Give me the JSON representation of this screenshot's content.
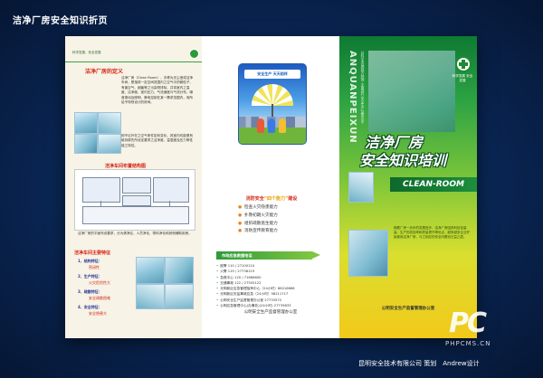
{
  "page": {
    "title": "洁净厂房安全知识折页"
  },
  "left": {
    "header_text": "科学发展，安全发展",
    "section1_title": "洁净厂房的定义",
    "section1_body": "洁净厂房（Clean Room），亦称为无尘室或洁净车间，是指将一定空间范围内之空气中的微粒子、有害空气、细菌等之污染物排除，并将室内之温度、洁净度、室内压力、气流速度与气流分布、噪音振动及照明、静电控制在某一需求范围内，而所给予特别设计的房间。",
    "section1_body2": "即不论外在之空气条件如何变化，其室内均能俱有维持原先所设定要求之洁净度、温湿度及压力等性能之特性。",
    "section2_title": "洁净车间布置结构图",
    "section2_body": "洁净厂房的平面布设要求，分为清净区、人员净化、物料净化和其他辅助用房。",
    "section3_title": "洁净车间主要特征",
    "features": [
      {
        "label": "1、结构特征：",
        "value": "密闭性"
      },
      {
        "label": "2、生产特征：",
        "value": "火灾危险性大"
      },
      {
        "label": "3、疏散特征：",
        "value": "安全疏散困难"
      },
      {
        "label": "4、安全特征：",
        "value": "安全隐患大"
      }
    ]
  },
  "middle": {
    "poster_title": "安全生产 天天相伴",
    "headline_prefix": "消防安全",
    "headline_quote": "“四个能力”",
    "headline_suffix": "建设",
    "capabilities": [
      "检查火灾隐患能力",
      "扑救初期火灾能力",
      "组织疏散逃生能力",
      "消防宣传教育能力"
    ],
    "emergency_title": "市政应急救援电话",
    "emergency": [
      "匪警 110 / 27100110",
      "火警 119 / 27738119",
      "急救中心 120 / 71666600",
      "交通事故 122 / 27555122",
      "光明新区应急管理指挥中心（24小时）88216666",
      "光明新区安监事故应急（24小时）98211717",
      "公明安全生产监督管理办公室 27733572",
      "公明应急管理中心(办事处)(24小时) 27739833"
    ],
    "footer": "公明安全生产监督管理办公室"
  },
  "right": {
    "vertical_en": "ANQUANPEIXUN",
    "vertical_cn": "以科学发展观为统领 全面提升安全生产监管水平",
    "logo_text": "科学发展 安全发展",
    "title_line1": "洁净厂房",
    "title_line2": "安全知识培训",
    "clean_room": "CLEAN-ROOM",
    "note": "随着厂房一步步的发展进步、洁净厂房因其科技含量高、生产的成品率和质量提升等优点，越来越多企业开始使用洁净厂房，与之相应的安全问题也日益凸显。",
    "footer": "公明安全生产监督管理办公室"
  },
  "brand": {
    "logo": "PC",
    "url": "PHPCMS.CN"
  },
  "credit": "昆明安全技术有限公司 策划　Andrew设计"
}
